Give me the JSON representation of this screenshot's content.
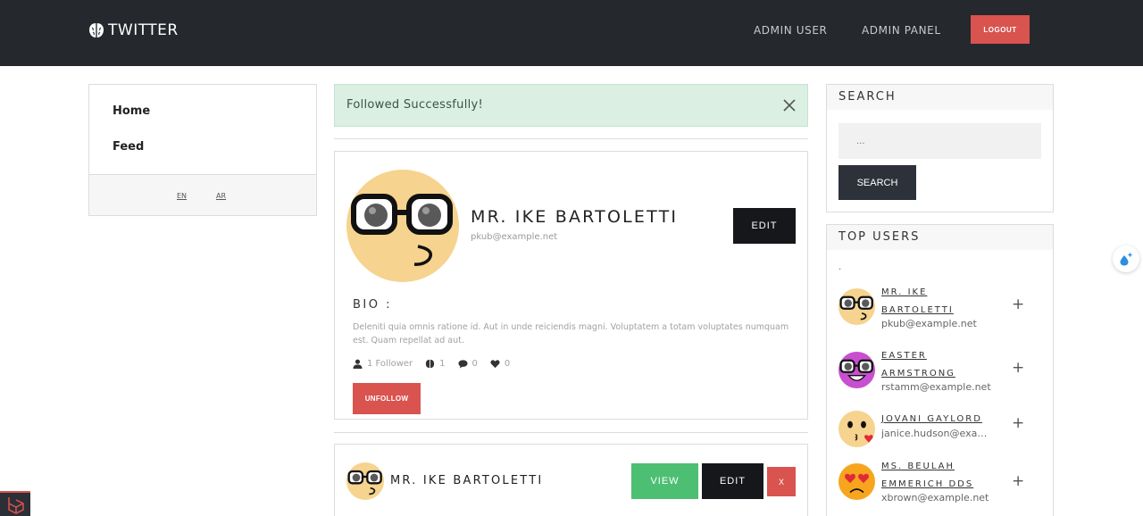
{
  "header": {
    "brand": "TWITTER",
    "nav": [
      "ADMIN USER",
      "ADMIN PANEL"
    ],
    "logout": "LOGOUT"
  },
  "sidebar": {
    "items": [
      {
        "label": "Home"
      },
      {
        "label": "Feed"
      }
    ],
    "langs": [
      "EN",
      "AR"
    ]
  },
  "alert": {
    "message": "Followed Successfully!"
  },
  "profile": {
    "name": "MR. IKE BARTOLETTI",
    "email": "pkub@example.net",
    "edit": "EDIT",
    "bio_label": "BIO :",
    "bio": "Deleniti quia omnis ratione id. Aut in unde reiciendis magni. Voluptatem a totam voluptates numquam est. Quam repellat ad aut.",
    "followers": "1 Follower",
    "tweets": "1",
    "comments": "0",
    "likes": "0",
    "unfollow": "UNFOLLOW"
  },
  "card2": {
    "name": "MR. IKE BARTOLETTI",
    "view": "VIEW",
    "edit": "EDIT",
    "delete": "X"
  },
  "search": {
    "title": "SEARCH",
    "placeholder": "...",
    "button": "SEARCH"
  },
  "top_users": {
    "title": "TOP USERS",
    "dot": ".",
    "users": [
      {
        "name": "MR. IKE BARTOLETTI",
        "email": "pkub@example.net",
        "avatar": "nerd-face-icon"
      },
      {
        "name": "EASTER ARMSTRONG",
        "email": "rstamm@example.net",
        "avatar": "purple-nerd-face-icon"
      },
      {
        "name": "JOVANI GAYLORD",
        "email": "janice.hudson@example.net",
        "avatar": "kissing-face-icon"
      },
      {
        "name": "MS. BEULAH EMMERICH DDS",
        "email": "xbrown@example.net",
        "avatar": "heart-eyes-sad-face-icon"
      }
    ]
  },
  "colors": {
    "header_bg": "#25282c",
    "danger": "#d9534f",
    "success": "#4dbf72",
    "dark_button": "#16171a",
    "alert_bg": "#dbefe3"
  }
}
